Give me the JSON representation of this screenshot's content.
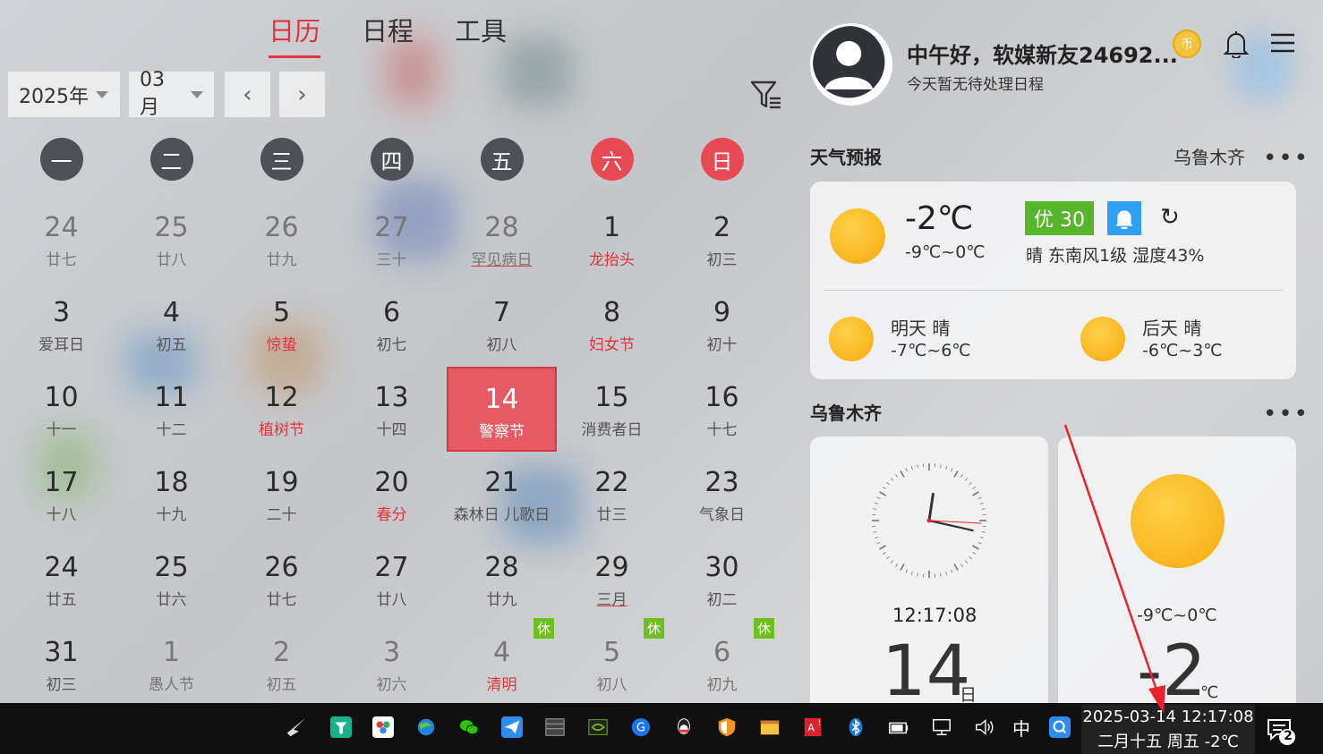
{
  "tabs": [
    {
      "label": "日历",
      "active": true
    },
    {
      "label": "日程",
      "active": false
    },
    {
      "label": "工具",
      "active": false
    }
  ],
  "controls": {
    "year": "2025年",
    "month": "03月",
    "prev": "‹",
    "next": "›"
  },
  "weekdays": [
    "一",
    "二",
    "三",
    "四",
    "五",
    "六",
    "日"
  ],
  "days": [
    {
      "n": "24",
      "s": "廿七",
      "other": true
    },
    {
      "n": "25",
      "s": "廿八",
      "other": true
    },
    {
      "n": "26",
      "s": "廿九",
      "other": true
    },
    {
      "n": "27",
      "s": "三十",
      "other": true
    },
    {
      "n": "28",
      "s": "罕见病日",
      "other": true,
      "ul": true
    },
    {
      "n": "1",
      "s": "龙抬头",
      "red": true
    },
    {
      "n": "2",
      "s": "初三"
    },
    {
      "n": "3",
      "s": "爱耳日"
    },
    {
      "n": "4",
      "s": "初五"
    },
    {
      "n": "5",
      "s": "惊蛰",
      "red": true
    },
    {
      "n": "6",
      "s": "初七"
    },
    {
      "n": "7",
      "s": "初八"
    },
    {
      "n": "8",
      "s": "妇女节",
      "red": true
    },
    {
      "n": "9",
      "s": "初十"
    },
    {
      "n": "10",
      "s": "十一"
    },
    {
      "n": "11",
      "s": "十二"
    },
    {
      "n": "12",
      "s": "植树节",
      "red": true
    },
    {
      "n": "13",
      "s": "十四"
    },
    {
      "n": "14",
      "s": "警察节",
      "today": true
    },
    {
      "n": "15",
      "s": "消费者日"
    },
    {
      "n": "16",
      "s": "十七"
    },
    {
      "n": "17",
      "s": "十八"
    },
    {
      "n": "18",
      "s": "十九"
    },
    {
      "n": "19",
      "s": "二十"
    },
    {
      "n": "20",
      "s": "春分",
      "red": true
    },
    {
      "n": "21",
      "s": "森林日 儿歌日"
    },
    {
      "n": "22",
      "s": "廿三"
    },
    {
      "n": "23",
      "s": "气象日"
    },
    {
      "n": "24",
      "s": "廿五"
    },
    {
      "n": "25",
      "s": "廿六"
    },
    {
      "n": "26",
      "s": "廿七"
    },
    {
      "n": "27",
      "s": "廿八"
    },
    {
      "n": "28",
      "s": "廿九"
    },
    {
      "n": "29",
      "s": "三月",
      "ul": true
    },
    {
      "n": "30",
      "s": "初二"
    },
    {
      "n": "31",
      "s": "初三"
    },
    {
      "n": "1",
      "s": "愚人节",
      "other": true
    },
    {
      "n": "2",
      "s": "初五",
      "other": true
    },
    {
      "n": "3",
      "s": "初六",
      "other": true
    },
    {
      "n": "4",
      "s": "清明",
      "other": true,
      "red": true,
      "badge": "休"
    },
    {
      "n": "5",
      "s": "初八",
      "other": true,
      "badge": "休"
    },
    {
      "n": "6",
      "s": "初九",
      "other": true,
      "badge": "休"
    }
  ],
  "user": {
    "greeting": "中午好，软媒新友24692...",
    "coin": "币",
    "subtitle": "今天暂无待处理日程"
  },
  "weather": {
    "title": "天气预报",
    "city": "乌鲁木齐",
    "more": "•••",
    "temp": "-2℃",
    "range": "-9℃~0℃",
    "aqi": "优 30",
    "desc": "晴  东南风1级  湿度43%",
    "tomorrow_label": "明天 晴",
    "tomorrow_range": "-7℃~6℃",
    "after_label": "后天 晴",
    "after_range": "-6℃~3℃"
  },
  "city_widget": {
    "title": "乌鲁木齐",
    "more": "•••",
    "time": "12:17:08",
    "day": "14",
    "day_unit": "日",
    "range": "-9℃~0℃",
    "temp": "-2",
    "unit": "℃",
    "clock": {
      "hour": 12,
      "minute": 17,
      "second": 8
    }
  },
  "taskbar": {
    "ime": "中",
    "datetime": "2025-03-14 12:17:08",
    "lunar": "二月十五 周五 -2℃",
    "notif_count": "2"
  },
  "colors": {
    "accent": "#e0353f",
    "weekday_bg": "#4d5056",
    "weekend_bg": "#e84a55",
    "today_bg": "#e85a63",
    "holiday_badge": "#6fbf21"
  }
}
